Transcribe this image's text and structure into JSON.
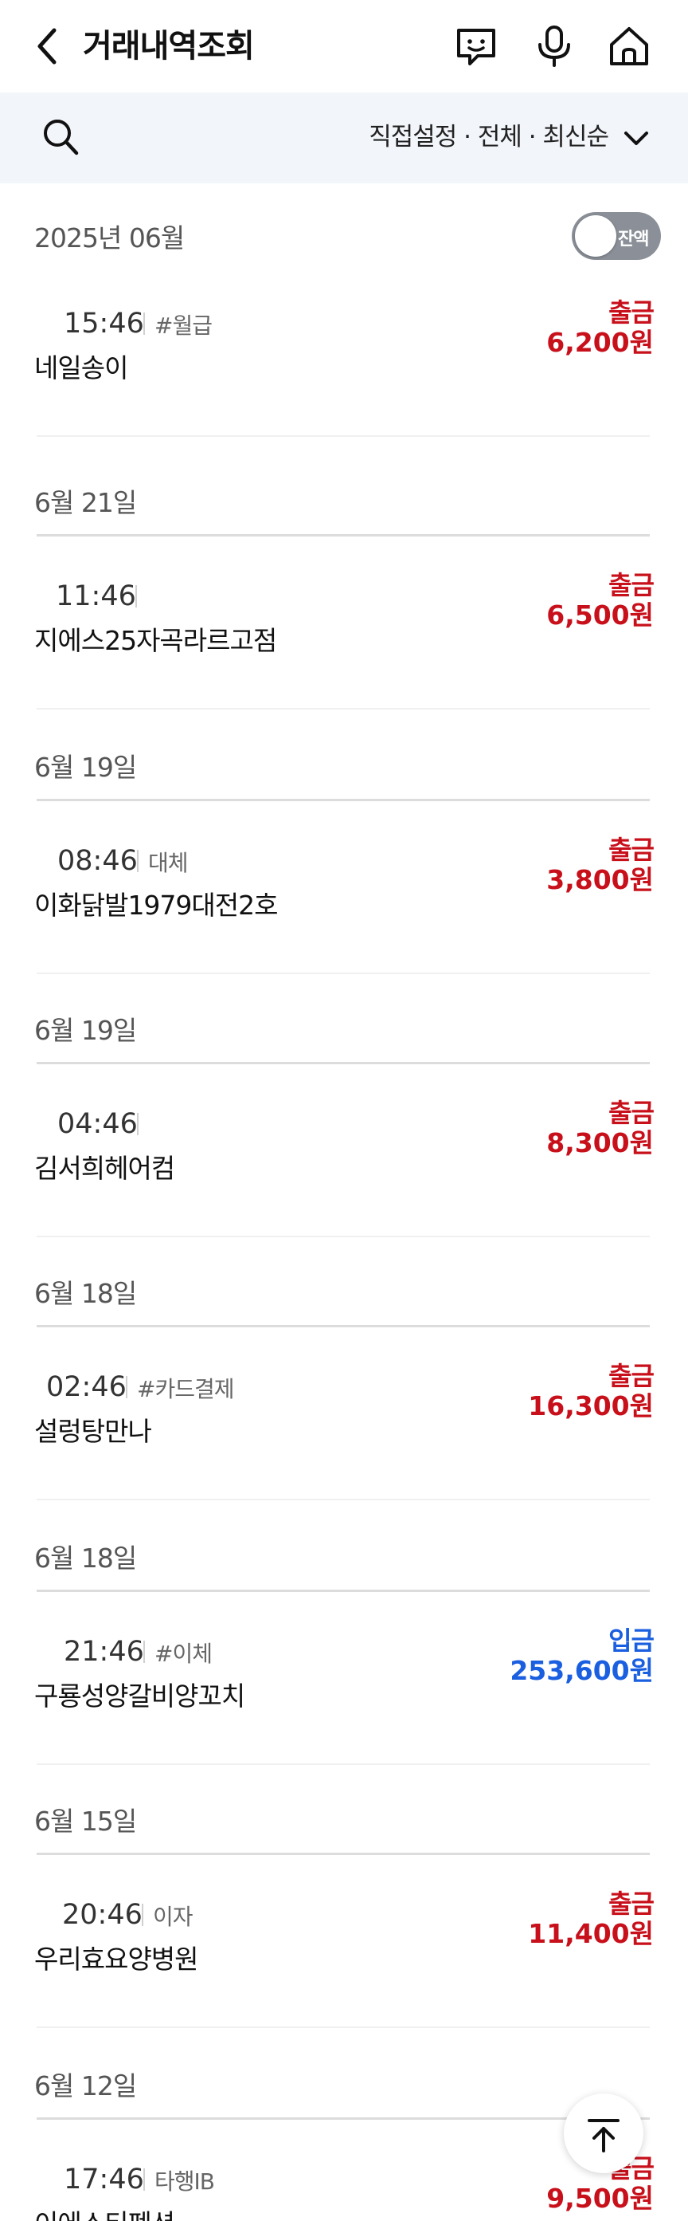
{
  "header": {
    "title": "거래내역조회",
    "icons": [
      "back-arrow-icon",
      "chatbot-icon",
      "microphone-icon",
      "home-icon"
    ]
  },
  "filter": {
    "text": "직접설정 · 전체 · 최신순"
  },
  "month_header": {
    "label": "2025년 06월",
    "balance_toggle_label": "잔액",
    "balance_toggle_on": false
  },
  "transactions": [
    {
      "date": "",
      "time": "15:46",
      "tag": "#월급",
      "merchant": "네일송이",
      "kind": "출금",
      "amount": "6,200원",
      "direction": "out"
    },
    {
      "date": "6월 21일",
      "time": "11:46",
      "tag": "",
      "merchant": "지에스25자곡라르고점",
      "kind": "출금",
      "amount": "6,500원",
      "direction": "out"
    },
    {
      "date": "6월 19일",
      "time": "08:46",
      "tag": "대체",
      "merchant": "이화닭발1979대전2호",
      "kind": "출금",
      "amount": "3,800원",
      "direction": "out"
    },
    {
      "date": "6월 19일",
      "time": "04:46",
      "tag": "",
      "merchant": "김서희헤어컴",
      "kind": "출금",
      "amount": "8,300원",
      "direction": "out"
    },
    {
      "date": "6월 18일",
      "time": "02:46",
      "tag": "#카드결제",
      "merchant": "설렁탕만나",
      "kind": "출금",
      "amount": "16,300원",
      "direction": "out"
    },
    {
      "date": "6월 18일",
      "time": "21:46",
      "tag": "#이체",
      "merchant": "구룡성양갈비양꼬치",
      "kind": "입금",
      "amount": "253,600원",
      "direction": "in"
    },
    {
      "date": "6월 15일",
      "time": "20:46",
      "tag": "이자",
      "merchant": "우리효요양병원",
      "kind": "출금",
      "amount": "11,400원",
      "direction": "out"
    },
    {
      "date": "6월 12일",
      "time": "17:46",
      "tag": "타행IB",
      "merchant": "이에스티펜션",
      "kind": "출금",
      "amount": "9,500원",
      "direction": "out"
    }
  ],
  "colors": {
    "withdrawal": "#c8101b",
    "deposit": "#1a5fe0",
    "filter_bg": "#f2f5fa"
  }
}
